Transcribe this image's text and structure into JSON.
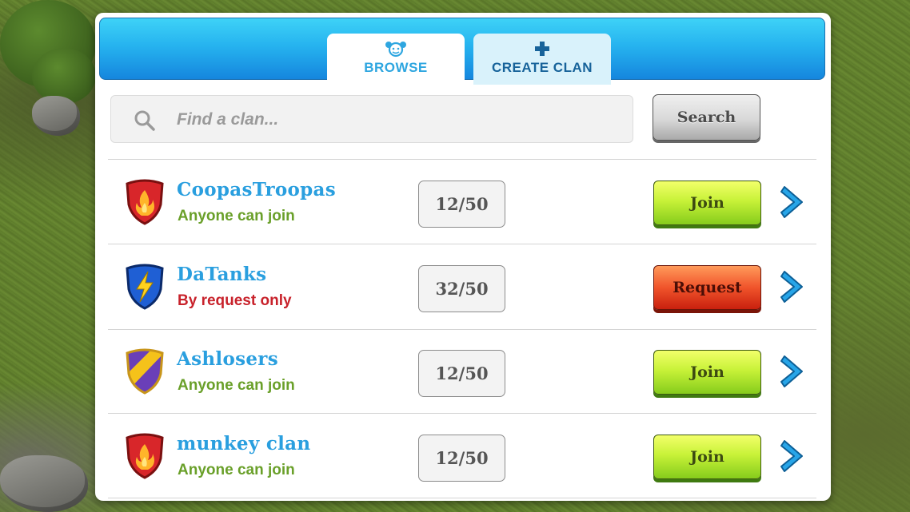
{
  "tabs": [
    {
      "label": "BROWSE",
      "icon": "face-icon",
      "active": true
    },
    {
      "label": "CREATE CLAN",
      "icon": "plus-icon",
      "active": false
    }
  ],
  "search": {
    "placeholder": "Find a clan...",
    "value": "",
    "button_label": "Search"
  },
  "clans": [
    {
      "name": "CoopasTroopas",
      "status": "Anyone can join",
      "members": "12/50",
      "action": "Join",
      "crest": "fire-shield-icon"
    },
    {
      "name": "DaTanks",
      "status": "By request only",
      "members": "32/50",
      "action": "Request",
      "crest": "lightning-shield-icon"
    },
    {
      "name": "Ashlosers",
      "status": "Anyone can join",
      "members": "12/50",
      "action": "Join",
      "crest": "striped-shield-icon"
    },
    {
      "name": "munkey clan",
      "status": "Anyone can join",
      "members": "12/50",
      "action": "Join",
      "crest": "fire-shield-icon"
    }
  ],
  "colors": {
    "tab_bar": "#26b3ef",
    "clan_name": "#2a9fdf",
    "open_status": "#6aa02a",
    "request_status": "#c8222b",
    "join_button": "#c8f238",
    "request_button": "#f0542b"
  }
}
